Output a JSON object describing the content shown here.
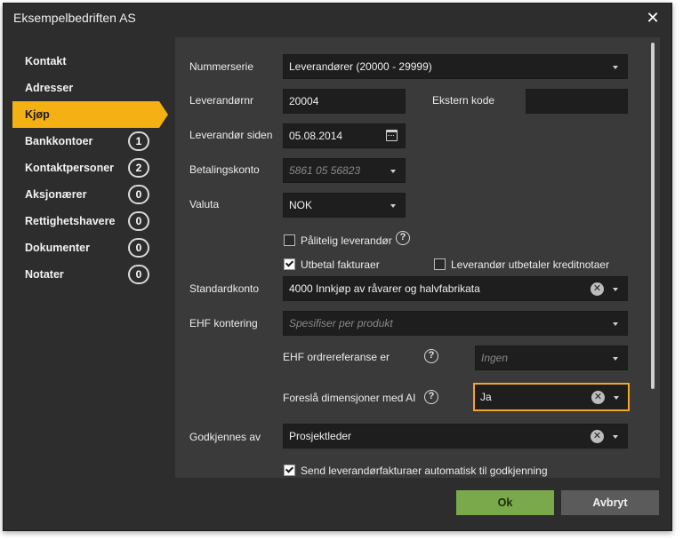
{
  "window": {
    "title": "Eksempelbedriften AS",
    "close_glyph": "✕"
  },
  "sidebar": {
    "items": [
      {
        "label": "Kontakt",
        "badge": ""
      },
      {
        "label": "Adresser",
        "badge": ""
      },
      {
        "label": "Kjøp",
        "badge": "",
        "active": true
      },
      {
        "label": "Bankkontoer",
        "badge": "1"
      },
      {
        "label": "Kontaktpersoner",
        "badge": "2"
      },
      {
        "label": "Aksjonærer",
        "badge": "0"
      },
      {
        "label": "Rettighetshavere",
        "badge": "0"
      },
      {
        "label": "Dokumenter",
        "badge": "0"
      },
      {
        "label": "Notater",
        "badge": "0"
      }
    ]
  },
  "form": {
    "nummerserie": {
      "label": "Nummerserie",
      "value": "Leverandører (20000 - 29999)"
    },
    "leverandornr": {
      "label": "Leverandørnr",
      "value": "20004"
    },
    "ekstern_kode": {
      "label": "Ekstern kode",
      "value": ""
    },
    "leverandor_siden": {
      "label": "Leverandør siden",
      "value": "05.08.2014"
    },
    "betalingskonto": {
      "label": "Betalingskonto",
      "placeholder": "5861 05 56823"
    },
    "valuta": {
      "label": "Valuta",
      "value": "NOK"
    },
    "palitelig": {
      "label": "Pålitelig leverandør",
      "checked": false,
      "help": "?"
    },
    "utbetal": {
      "label": "Utbetal fakturaer",
      "checked": true
    },
    "kreditnotaer": {
      "label": "Leverandør utbetaler kreditnotaer",
      "checked": false
    },
    "standardkonto": {
      "label": "Standardkonto",
      "value": "4000 Innkjøp av råvarer og halvfabrikata"
    },
    "ehf_kontering": {
      "label": "EHF kontering",
      "placeholder": "Spesifiser per produkt"
    },
    "ehf_ordreref": {
      "label": "EHF ordrereferanse er",
      "placeholder": "Ingen",
      "help": "?"
    },
    "dimensjoner": {
      "label": "Foreslå dimensjoner med AI",
      "value": "Ja",
      "help": "?"
    },
    "godkjennes": {
      "label": "Godkjennes av",
      "value": "Prosjektleder"
    },
    "send_godkjenning": {
      "label": "Send leverandørfakturaer automatisk til godkjenning",
      "checked": true
    }
  },
  "footer": {
    "ok_label": "Ok",
    "cancel_label": "Avbryt"
  },
  "colors": {
    "accent": "#f5b014",
    "ok": "#79a94a",
    "highlight": "#f5a623"
  }
}
